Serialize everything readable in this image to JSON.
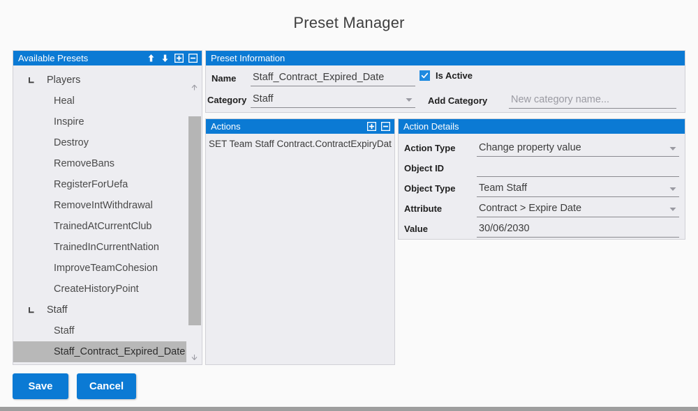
{
  "window": {
    "title": "Preset Manager"
  },
  "presets_panel": {
    "header": "Available Presets",
    "tools": [
      {
        "name": "move-up-icon",
        "label": "Move Up"
      },
      {
        "name": "move-down-icon",
        "label": "Move Down"
      },
      {
        "name": "add-preset-icon",
        "label": "Add"
      },
      {
        "name": "remove-preset-icon",
        "label": "Remove"
      }
    ],
    "tree": [
      {
        "label": "Players",
        "type": "group",
        "expanded": true
      },
      {
        "label": "Heal",
        "type": "child"
      },
      {
        "label": "Inspire",
        "type": "child"
      },
      {
        "label": "Destroy",
        "type": "child"
      },
      {
        "label": "RemoveBans",
        "type": "child"
      },
      {
        "label": "RegisterForUefa",
        "type": "child"
      },
      {
        "label": "RemoveIntWithdrawal",
        "type": "child"
      },
      {
        "label": "TrainedAtCurrentClub",
        "type": "child"
      },
      {
        "label": "TrainedInCurrentNation",
        "type": "child"
      },
      {
        "label": "ImproveTeamCohesion",
        "type": "child"
      },
      {
        "label": "CreateHistoryPoint",
        "type": "child"
      },
      {
        "label": "Staff",
        "type": "group",
        "expanded": true
      },
      {
        "label": "Staff",
        "type": "child"
      },
      {
        "label": "Staff_Contract_Expired_Date",
        "type": "child",
        "selected": true
      }
    ]
  },
  "preset_information": {
    "header": "Preset Information",
    "name_label": "Name",
    "name_value": "Staff_Contract_Expired_Date",
    "category_label": "Category",
    "category_value": "Staff",
    "is_active_label": "Is Active",
    "is_active_checked": true,
    "add_category_label": "Add Category",
    "add_category_value": "",
    "add_category_placeholder": "New category name..."
  },
  "actions_panel": {
    "header": "Actions",
    "tools": [
      {
        "name": "add-action-icon",
        "label": "Add"
      },
      {
        "name": "remove-action-icon",
        "label": "Remove"
      }
    ],
    "items": [
      "SET Team Staff Contract.ContractExpiryDat"
    ]
  },
  "action_details": {
    "header": "Action Details",
    "rows": [
      {
        "label": "Action Type",
        "value": "Change property value",
        "control": "combo"
      },
      {
        "label": "Object ID",
        "value": "",
        "control": "text"
      },
      {
        "label": "Object Type",
        "value": "Team Staff",
        "control": "combo"
      },
      {
        "label": "Attribute",
        "value": "Contract > Expire Date",
        "control": "combo"
      },
      {
        "label": "Value",
        "value": "30/06/2030",
        "control": "text"
      }
    ]
  },
  "footer": {
    "save_label": "Save",
    "cancel_label": "Cancel"
  },
  "colors": {
    "accent": "#0B7AD4",
    "panel_bg": "#EDEDF1",
    "selection": "#B8B8B8",
    "page_bg": "#FAFAFA"
  }
}
